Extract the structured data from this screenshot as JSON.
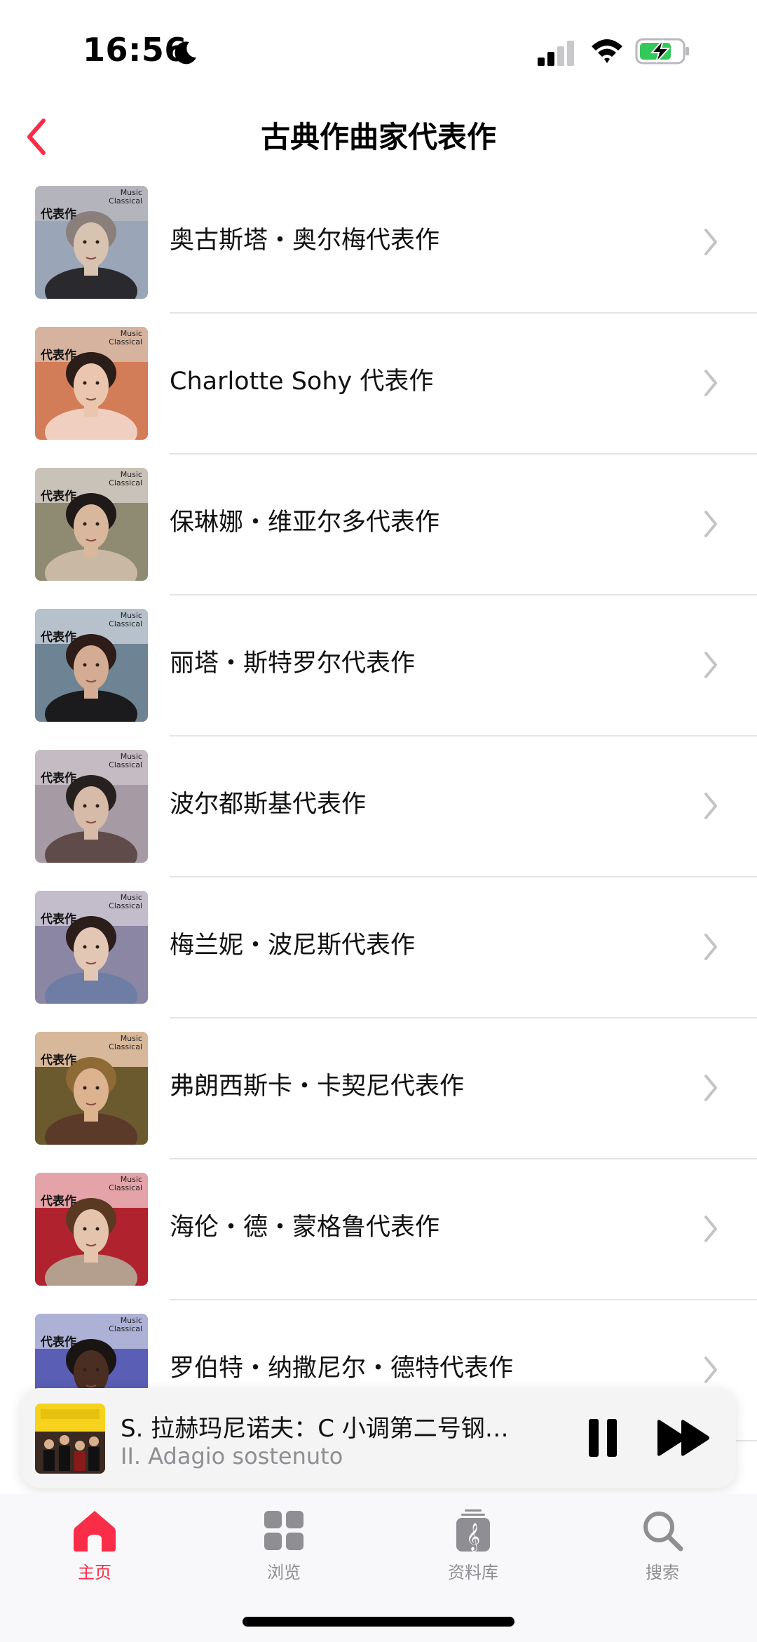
{
  "status_bar": {
    "time": "16:56",
    "icons": [
      "moon-icon",
      "cellular-signal-icon",
      "wifi-icon",
      "battery-charging-icon"
    ]
  },
  "nav": {
    "title": "古典作曲家代表作",
    "back_icon": "chevron-left-icon"
  },
  "colors": {
    "accent": "#fa2d48",
    "separator": "#e4e4e6",
    "secondary_text": "#8e8e93"
  },
  "thumb_common": {
    "label": "代表作",
    "brand_line1": "Music",
    "brand_line2": "Classical"
  },
  "items": [
    {
      "label": "奥古斯塔・奥尔梅代表作",
      "band": "#b4b4bd",
      "bg": "#9aa5b8",
      "skin": "#d8c2b0",
      "hair": "#8a7f7a",
      "dress": "#2a2a2e"
    },
    {
      "label": "Charlotte Sohy 代表作",
      "band": "#d6b39f",
      "bg": "#d27c58",
      "skin": "#ebc6ae",
      "hair": "#2b1d18",
      "dress": "#f0cfc0"
    },
    {
      "label": "保琳娜・维亚尔多代表作",
      "band": "#c9c2b8",
      "bg": "#8f8a72",
      "skin": "#d9b79c",
      "hair": "#1f1a18",
      "dress": "#c9b8a4"
    },
    {
      "label": "丽塔・斯特罗尔代表作",
      "band": "#b7c1cb",
      "bg": "#6e8394",
      "skin": "#d4ac93",
      "hair": "#2d1c18",
      "dress": "#1b1b1d"
    },
    {
      "label": "波尔都斯基代表作",
      "band": "#c4bcc2",
      "bg": "#a69aa4",
      "skin": "#d6bba8",
      "hair": "#26201f",
      "dress": "#5f4c4a"
    },
    {
      "label": "梅兰妮・波尼斯代表作",
      "band": "#c3bccb",
      "bg": "#8a86a3",
      "skin": "#e2c7b5",
      "hair": "#2a1d1a",
      "dress": "#6d7da3"
    },
    {
      "label": "弗朗西斯卡・卡契尼代表作",
      "band": "#d8b89a",
      "bg": "#6b5a2e",
      "skin": "#dcb28f",
      "hair": "#8e6a35",
      "dress": "#5b3a2a"
    },
    {
      "label": "海伦・德・蒙格鲁代表作",
      "band": "#e3a3a8",
      "bg": "#b0222e",
      "skin": "#e4c4ad",
      "hair": "#5b3822",
      "dress": "#b49e8e"
    },
    {
      "label": "罗伯特・纳撒尼尔・德特代表作",
      "band": "#aeb1d6",
      "bg": "#5a5eb5",
      "skin": "#4b2e22",
      "hair": "#1a1412",
      "dress": "#3d3f8c"
    }
  ],
  "row_icon": "chevron-right-icon",
  "mini_player": {
    "title": "S. 拉赫玛尼诺夫：C 小调第二号钢…",
    "subtitle": "II. Adagio sostenuto",
    "pause_icon": "pause-icon",
    "forward_icon": "fast-forward-icon"
  },
  "tabs": [
    {
      "label": "主页",
      "icon": "home-icon",
      "active": true
    },
    {
      "label": "浏览",
      "icon": "grid-icon",
      "active": false
    },
    {
      "label": "资料库",
      "icon": "music-library-icon",
      "active": false
    },
    {
      "label": "搜索",
      "icon": "search-icon",
      "active": false
    }
  ]
}
